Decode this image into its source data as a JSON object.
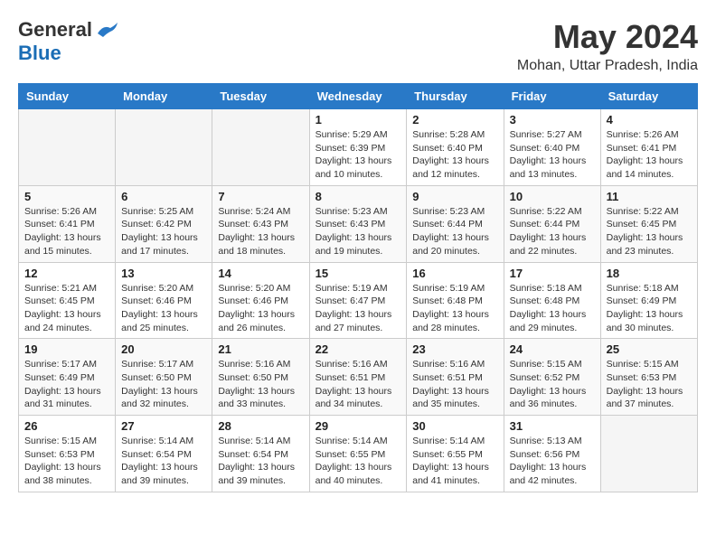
{
  "logo": {
    "line1": "General",
    "line2": "Blue"
  },
  "title": {
    "month": "May 2024",
    "location": "Mohan, Uttar Pradesh, India"
  },
  "days_of_week": [
    "Sunday",
    "Monday",
    "Tuesday",
    "Wednesday",
    "Thursday",
    "Friday",
    "Saturday"
  ],
  "weeks": [
    [
      {
        "day": "",
        "info": ""
      },
      {
        "day": "",
        "info": ""
      },
      {
        "day": "",
        "info": ""
      },
      {
        "day": "1",
        "info": "Sunrise: 5:29 AM\nSunset: 6:39 PM\nDaylight: 13 hours\nand 10 minutes."
      },
      {
        "day": "2",
        "info": "Sunrise: 5:28 AM\nSunset: 6:40 PM\nDaylight: 13 hours\nand 12 minutes."
      },
      {
        "day": "3",
        "info": "Sunrise: 5:27 AM\nSunset: 6:40 PM\nDaylight: 13 hours\nand 13 minutes."
      },
      {
        "day": "4",
        "info": "Sunrise: 5:26 AM\nSunset: 6:41 PM\nDaylight: 13 hours\nand 14 minutes."
      }
    ],
    [
      {
        "day": "5",
        "info": "Sunrise: 5:26 AM\nSunset: 6:41 PM\nDaylight: 13 hours\nand 15 minutes."
      },
      {
        "day": "6",
        "info": "Sunrise: 5:25 AM\nSunset: 6:42 PM\nDaylight: 13 hours\nand 17 minutes."
      },
      {
        "day": "7",
        "info": "Sunrise: 5:24 AM\nSunset: 6:43 PM\nDaylight: 13 hours\nand 18 minutes."
      },
      {
        "day": "8",
        "info": "Sunrise: 5:23 AM\nSunset: 6:43 PM\nDaylight: 13 hours\nand 19 minutes."
      },
      {
        "day": "9",
        "info": "Sunrise: 5:23 AM\nSunset: 6:44 PM\nDaylight: 13 hours\nand 20 minutes."
      },
      {
        "day": "10",
        "info": "Sunrise: 5:22 AM\nSunset: 6:44 PM\nDaylight: 13 hours\nand 22 minutes."
      },
      {
        "day": "11",
        "info": "Sunrise: 5:22 AM\nSunset: 6:45 PM\nDaylight: 13 hours\nand 23 minutes."
      }
    ],
    [
      {
        "day": "12",
        "info": "Sunrise: 5:21 AM\nSunset: 6:45 PM\nDaylight: 13 hours\nand 24 minutes."
      },
      {
        "day": "13",
        "info": "Sunrise: 5:20 AM\nSunset: 6:46 PM\nDaylight: 13 hours\nand 25 minutes."
      },
      {
        "day": "14",
        "info": "Sunrise: 5:20 AM\nSunset: 6:46 PM\nDaylight: 13 hours\nand 26 minutes."
      },
      {
        "day": "15",
        "info": "Sunrise: 5:19 AM\nSunset: 6:47 PM\nDaylight: 13 hours\nand 27 minutes."
      },
      {
        "day": "16",
        "info": "Sunrise: 5:19 AM\nSunset: 6:48 PM\nDaylight: 13 hours\nand 28 minutes."
      },
      {
        "day": "17",
        "info": "Sunrise: 5:18 AM\nSunset: 6:48 PM\nDaylight: 13 hours\nand 29 minutes."
      },
      {
        "day": "18",
        "info": "Sunrise: 5:18 AM\nSunset: 6:49 PM\nDaylight: 13 hours\nand 30 minutes."
      }
    ],
    [
      {
        "day": "19",
        "info": "Sunrise: 5:17 AM\nSunset: 6:49 PM\nDaylight: 13 hours\nand 31 minutes."
      },
      {
        "day": "20",
        "info": "Sunrise: 5:17 AM\nSunset: 6:50 PM\nDaylight: 13 hours\nand 32 minutes."
      },
      {
        "day": "21",
        "info": "Sunrise: 5:16 AM\nSunset: 6:50 PM\nDaylight: 13 hours\nand 33 minutes."
      },
      {
        "day": "22",
        "info": "Sunrise: 5:16 AM\nSunset: 6:51 PM\nDaylight: 13 hours\nand 34 minutes."
      },
      {
        "day": "23",
        "info": "Sunrise: 5:16 AM\nSunset: 6:51 PM\nDaylight: 13 hours\nand 35 minutes."
      },
      {
        "day": "24",
        "info": "Sunrise: 5:15 AM\nSunset: 6:52 PM\nDaylight: 13 hours\nand 36 minutes."
      },
      {
        "day": "25",
        "info": "Sunrise: 5:15 AM\nSunset: 6:53 PM\nDaylight: 13 hours\nand 37 minutes."
      }
    ],
    [
      {
        "day": "26",
        "info": "Sunrise: 5:15 AM\nSunset: 6:53 PM\nDaylight: 13 hours\nand 38 minutes."
      },
      {
        "day": "27",
        "info": "Sunrise: 5:14 AM\nSunset: 6:54 PM\nDaylight: 13 hours\nand 39 minutes."
      },
      {
        "day": "28",
        "info": "Sunrise: 5:14 AM\nSunset: 6:54 PM\nDaylight: 13 hours\nand 39 minutes."
      },
      {
        "day": "29",
        "info": "Sunrise: 5:14 AM\nSunset: 6:55 PM\nDaylight: 13 hours\nand 40 minutes."
      },
      {
        "day": "30",
        "info": "Sunrise: 5:14 AM\nSunset: 6:55 PM\nDaylight: 13 hours\nand 41 minutes."
      },
      {
        "day": "31",
        "info": "Sunrise: 5:13 AM\nSunset: 6:56 PM\nDaylight: 13 hours\nand 42 minutes."
      },
      {
        "day": "",
        "info": ""
      }
    ]
  ]
}
